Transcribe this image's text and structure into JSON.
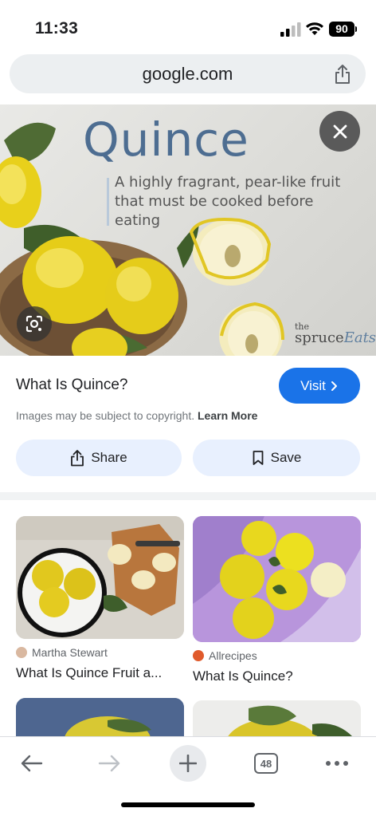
{
  "status_bar": {
    "time": "11:33",
    "battery": "90"
  },
  "address_bar": {
    "url": "google.com"
  },
  "hero": {
    "title": "Quince",
    "subtitle": "A highly fragrant, pear-like fruit that must be cooked before eating",
    "brand_the": "the",
    "brand_name": "spruce",
    "brand_eats": "Eats"
  },
  "info": {
    "title": "What Is Quince?",
    "visit_label": "Visit",
    "copyright": "Images may be subject to copyright.",
    "learn_more": "Learn More",
    "share_label": "Share",
    "save_label": "Save"
  },
  "results": [
    {
      "source": "Martha Stewart",
      "title": "What Is Quince Fruit a..."
    },
    {
      "source": "Allrecipes",
      "title": "What Is Quince?"
    }
  ],
  "toolbar": {
    "tab_count": "48"
  },
  "colors": {
    "accent": "#1a73e8",
    "pill_bg": "#e8f0fe",
    "hero_title": "#4d6d91"
  }
}
